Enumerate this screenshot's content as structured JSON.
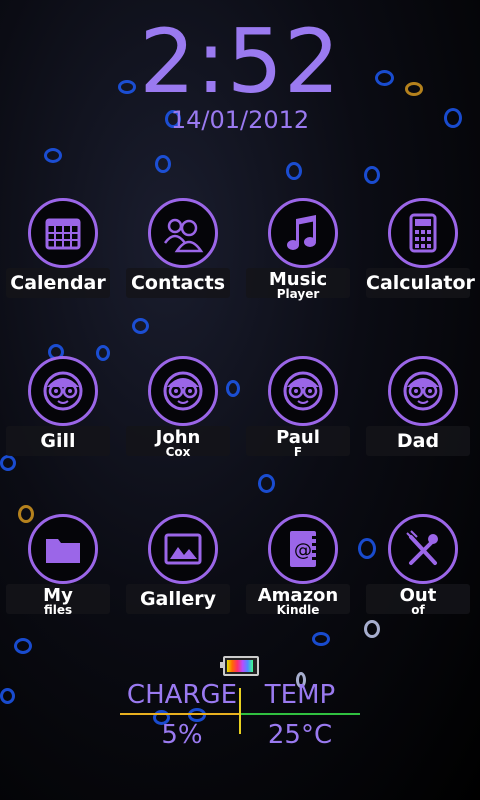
{
  "clock": {
    "time": "2:52",
    "date": "14/01/2012"
  },
  "apps": [
    {
      "name": "app-calendar",
      "icon": "calendar-icon",
      "line1": "Calendar",
      "line2": ""
    },
    {
      "name": "app-contacts",
      "icon": "contacts-icon",
      "line1": "Contacts",
      "line2": ""
    },
    {
      "name": "app-music-player",
      "icon": "music-icon",
      "line1": "Music",
      "line2": "Player"
    },
    {
      "name": "app-calculator",
      "icon": "calculator-icon",
      "line1": "Calculator",
      "line2": ""
    },
    {
      "name": "contact-gill",
      "icon": "face-icon",
      "line1": "Gill",
      "line2": ""
    },
    {
      "name": "contact-john-cox",
      "icon": "face-icon",
      "line1": "John",
      "line2": "Cox"
    },
    {
      "name": "contact-paul-f",
      "icon": "face-icon",
      "line1": "Paul",
      "line2": "F"
    },
    {
      "name": "contact-dad",
      "icon": "face-icon",
      "line1": "Dad",
      "line2": ""
    },
    {
      "name": "app-my-files",
      "icon": "folder-icon",
      "line1": "My",
      "line2": "files"
    },
    {
      "name": "app-gallery",
      "icon": "gallery-icon",
      "line1": "Gallery",
      "line2": ""
    },
    {
      "name": "app-amazon-kindle",
      "icon": "book-icon",
      "line1": "Amazon",
      "line2": "Kindle"
    },
    {
      "name": "app-out-of",
      "icon": "utensils-icon",
      "line1": "Out",
      "line2": "of"
    }
  ],
  "battery_widget": {
    "charge_label": "CHARGE",
    "charge_value": "5%",
    "temp_label": "TEMP",
    "temp_value": "25°C",
    "icon": "battery-icon"
  }
}
